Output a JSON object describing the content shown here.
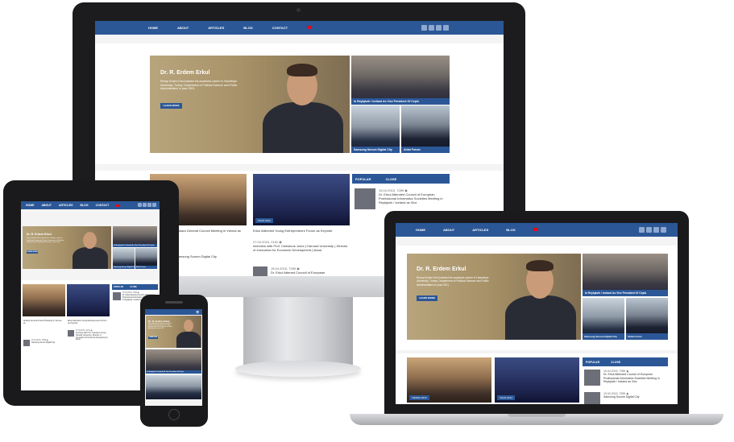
{
  "site": {
    "nav": [
      "HOME",
      "ABOUT",
      "ARTICLES",
      "BLOG",
      "CONTACT"
    ],
    "hero_name": "Dr. R. Erdem Erkul",
    "hero_intro": "Recep Erdem Erkul started his academic career in Hacettepe University, Turkey, Department of Political Science and Public Administration in year 2001.",
    "learn_more": "LEARN MORE",
    "featured": [
      {
        "caption": "In Reykjavik / Iceland As Vice President Of Cepis"
      },
      {
        "caption": "Samsung Sunum Digital City"
      },
      {
        "caption": "Ahlat Forum"
      }
    ],
    "tabs": [
      "POPULAR",
      "CLOSE"
    ],
    "news": [
      {
        "date": "15.04.2015, 7289 ◉",
        "title": "Dr. Erkul Attended Council of European Professional Informatics Societies Meeting in Reykjavik / Iceland as Vice"
      },
      {
        "date": "27.04.2015, 2151 ◉",
        "title": "Interview with Prof. Celestous Juma ( Harvard University ) Director of Innovation for Economic Development | about"
      },
      {
        "date": "15.04.2015, 7289 ◉",
        "title": "Dr. Erkul Attened Council of European"
      }
    ],
    "photo_captions": [
      "Ankara General Council Meeting in Vienna as",
      "Erkul Attended Young Entrepreneurs Forum as Keynote"
    ],
    "photo_tags": [
      "VIENNA 2015",
      "TALIN 2014"
    ],
    "side_news": "Samsung Sunum Digital City"
  },
  "colors": {
    "brand": "#2b5797",
    "flag": "#e30a17"
  }
}
